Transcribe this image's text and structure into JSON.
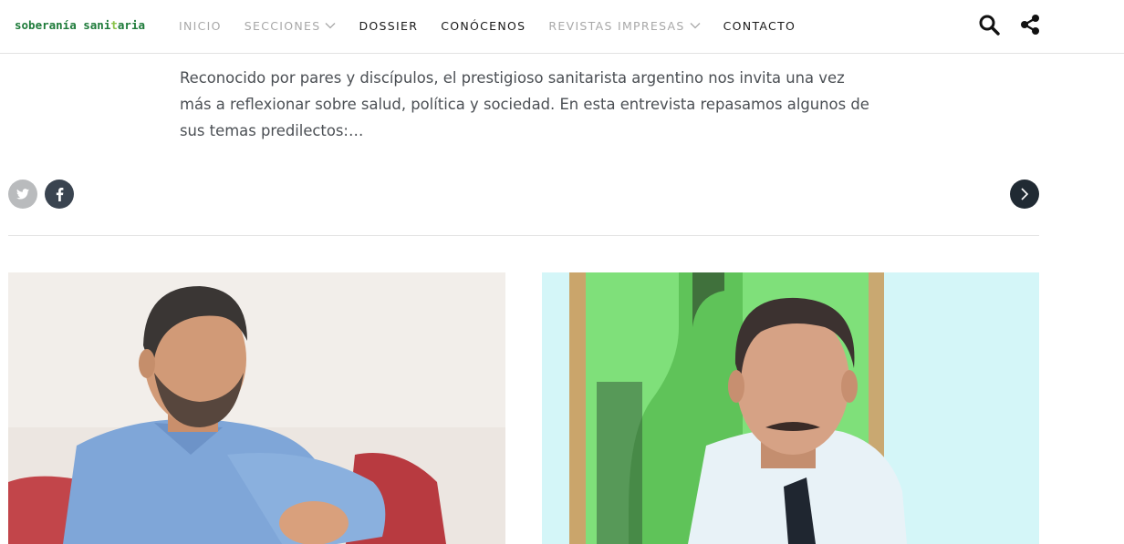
{
  "header": {
    "logo": {
      "text_main": "soberanía sani",
      "text_accent": "t",
      "text_end": "aria"
    },
    "nav": [
      {
        "label": "INICIO",
        "style": "muted",
        "dropdown": false
      },
      {
        "label": "SECCIONES",
        "style": "muted",
        "dropdown": true
      },
      {
        "label": "DOSSIER",
        "style": "dark",
        "dropdown": false
      },
      {
        "label": "CONÓCENOS",
        "style": "dark",
        "dropdown": false
      },
      {
        "label": "REVISTAS IMPRESAS",
        "style": "muted",
        "dropdown": true
      },
      {
        "label": "CONTACTO",
        "style": "dark",
        "dropdown": false
      }
    ],
    "icons": [
      "search-icon",
      "share-icon"
    ]
  },
  "article": {
    "excerpt": "Reconocido por pares y discípulos, el prestigioso sanitarista argentino nos invita una vez más a reflexionar sobre salud, política y sociedad. En esta entrevista repasamos algunos de sus temas predilectos:…"
  },
  "social": {
    "icons": [
      "twitter-icon",
      "facebook-icon"
    ],
    "next": "chevron-right-icon"
  },
  "colors": {
    "logo_green": "#1e7b3a",
    "logo_accent": "#8bc34a",
    "nav_muted": "#a8a8a8",
    "nav_dark": "#1a1a1a",
    "body_text": "#4b4f54",
    "facebook_bg": "#3a4450",
    "twitter_bg": "#b9bbbd",
    "next_bg": "#202a33"
  }
}
